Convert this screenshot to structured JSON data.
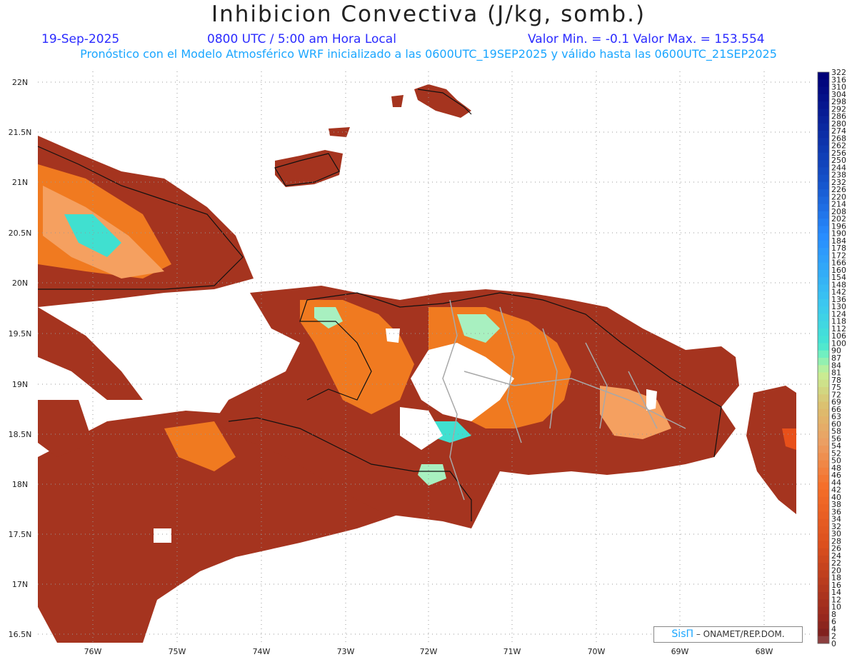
{
  "title": "Inhibicion Convectiva (J/kg, somb.)",
  "date": "19-Sep-2025",
  "time": "0800 UTC / 5:00 am Hora Local",
  "min_max": "Valor Min. = -0.1  Valor Max. = 153.554",
  "subtitle": "Pronóstico con el Modelo Atmosférico WRF inicializado a las 0600UTC_19SEP2025 y válido hasta las  0600UTC_21SEP2025",
  "credit": {
    "brand": "SisΠ",
    "text": " – ONAMET/REP.DOM."
  },
  "axes": {
    "lat_labels": [
      "22N",
      "21.5N",
      "21N",
      "20.5N",
      "20N",
      "19.5N",
      "19N",
      "18.5N",
      "18N",
      "17.5N",
      "17N",
      "16.5N"
    ],
    "lon_labels": [
      "76W",
      "75W",
      "74W",
      "73W",
      "72W",
      "71W",
      "70W",
      "69W",
      "68W"
    ]
  },
  "colorbar": {
    "labels": [
      "322",
      "316",
      "310",
      "304",
      "298",
      "292",
      "286",
      "280",
      "274",
      "268",
      "262",
      "256",
      "250",
      "244",
      "238",
      "232",
      "226",
      "220",
      "214",
      "208",
      "202",
      "196",
      "190",
      "184",
      "178",
      "172",
      "166",
      "160",
      "154",
      "148",
      "142",
      "136",
      "130",
      "124",
      "118",
      "112",
      "106",
      "100",
      "90",
      "87",
      "84",
      "81",
      "78",
      "75",
      "72",
      "69",
      "66",
      "63",
      "60",
      "58",
      "56",
      "54",
      "52",
      "50",
      "48",
      "46",
      "44",
      "42",
      "40",
      "38",
      "36",
      "34",
      "32",
      "30",
      "28",
      "26",
      "24",
      "22",
      "20",
      "18",
      "16",
      "14",
      "12",
      "10",
      "8",
      "6",
      "4",
      "2",
      "0"
    ]
  },
  "colors": {
    "land_fill": "#a5341f",
    "high": "#e8501a",
    "mid": "#f07a20",
    "low_green": "#a8f0c0",
    "high_cyan": "#40e0d0"
  }
}
